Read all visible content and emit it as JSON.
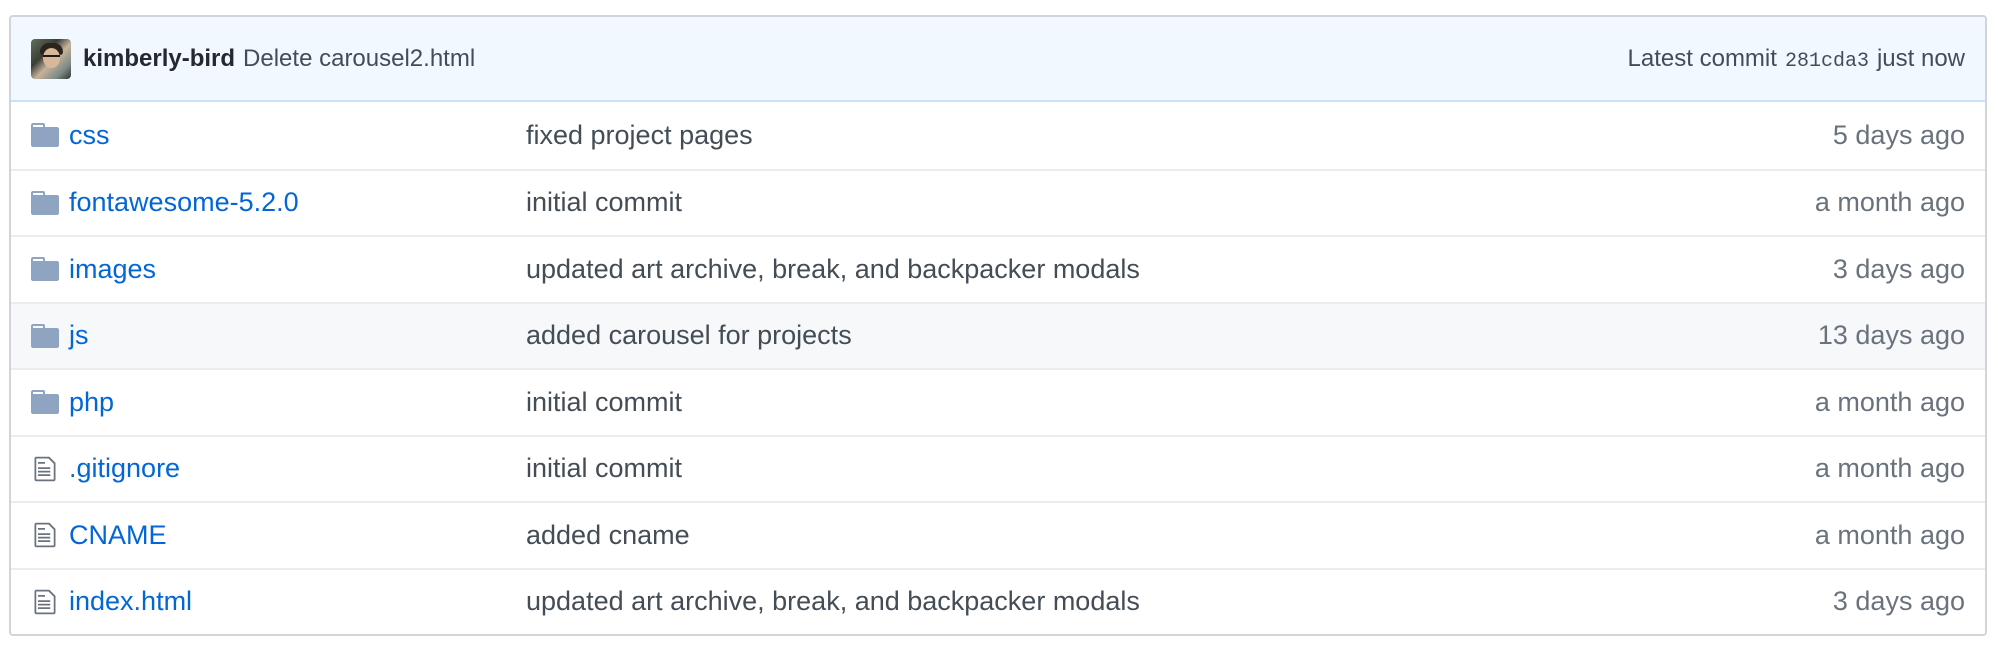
{
  "commit": {
    "author": "kimberly-bird",
    "message": "Delete carousel2.html",
    "latest_label": "Latest commit",
    "sha": "281cda3",
    "time": "just now"
  },
  "files": [
    {
      "type": "directory",
      "icon": "folder-icon",
      "name": "css",
      "message": "fixed project pages",
      "age": "5 days ago"
    },
    {
      "type": "directory",
      "icon": "folder-icon",
      "name": "fontawesome-5.2.0",
      "message": "initial commit",
      "age": "a month ago"
    },
    {
      "type": "directory",
      "icon": "folder-icon",
      "name": "images",
      "message": "updated art archive, break, and backpacker modals",
      "age": "3 days ago"
    },
    {
      "type": "directory",
      "icon": "folder-icon",
      "name": "js",
      "message": "added carousel for projects",
      "age": "13 days ago"
    },
    {
      "type": "directory",
      "icon": "folder-icon",
      "name": "php",
      "message": "initial commit",
      "age": "a month ago"
    },
    {
      "type": "file",
      "icon": "file-icon",
      "name": ".gitignore",
      "message": "initial commit",
      "age": "a month ago"
    },
    {
      "type": "file",
      "icon": "file-icon",
      "name": "CNAME",
      "message": "added cname",
      "age": "a month ago"
    },
    {
      "type": "file",
      "icon": "file-icon",
      "name": "index.html",
      "message": "updated art archive, break, and backpacker modals",
      "age": "3 days ago"
    }
  ],
  "colors": {
    "link": "#0366d6",
    "header_bg": "#f1f8ff",
    "folder_icon": "#79b8ff",
    "hover_row_bg": "#f6f8fa"
  }
}
